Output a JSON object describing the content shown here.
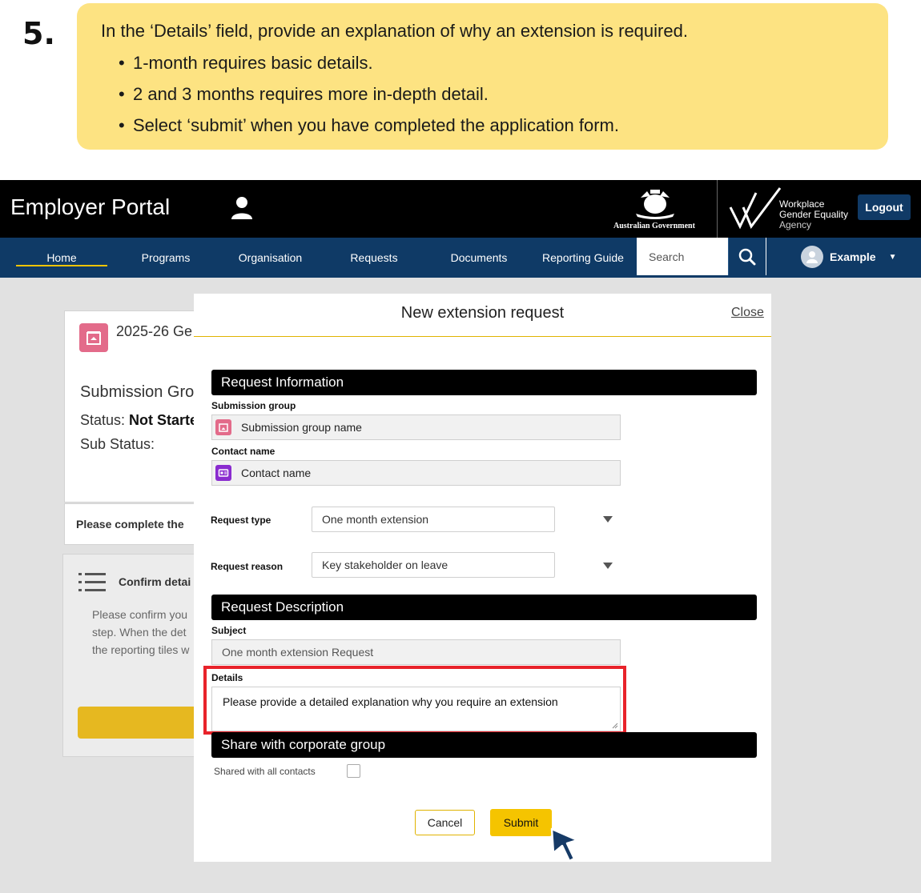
{
  "instruction": {
    "step_number": "5.",
    "main_text": "In the ‘Details’ field, provide an explanation of why an extension is required.",
    "bullets": [
      "1-month requires basic details.",
      "2 and 3 months requires more in-depth detail.",
      "Select ‘submit’ when you have completed the application form."
    ]
  },
  "header": {
    "portal_title": "Employer Portal",
    "govt_logo_text": "Australian Government",
    "agency_name_line1": "Workplace",
    "agency_name_line2": "Gender Equality",
    "agency_name_line3": "Agency",
    "logout_label": "Logout"
  },
  "nav": {
    "items": [
      "Home",
      "Programs",
      "Organisation",
      "Requests",
      "Documents",
      "Reporting Guide"
    ],
    "active": "Home",
    "search_placeholder": "Search",
    "user_name": "Example"
  },
  "background_page": {
    "card_title": "2025-26 Ge",
    "submission_group": "Submission Gro",
    "status_label": "Status:",
    "status_value": "Not Starte",
    "sub_status_label": "Sub Status:",
    "notice_text": "Please complete the",
    "confirm_title": "Confirm detai",
    "confirm_lines": [
      "Please confirm you",
      "step. When the det",
      "the reporting tiles w"
    ]
  },
  "modal": {
    "title": "New extension request",
    "close_label": "Close",
    "section_request_info": "Request Information",
    "submission_group_label": "Submission group",
    "submission_group_value": "Submission group name",
    "contact_name_label": "Contact name",
    "contact_name_value": "Contact name",
    "request_type_label": "Request type",
    "request_type_value": "One month extension",
    "request_reason_label": "Request reason",
    "request_reason_value": "Key stakeholder on leave",
    "section_request_description": "Request Description",
    "subject_label": "Subject",
    "subject_value": "One month extension Request",
    "details_label": "Details",
    "details_value": "Please provide a detailed explanation why you require an extension",
    "section_share": "Share with corporate group",
    "shared_label": "Shared with all contacts",
    "cancel_label": "Cancel",
    "submit_label": "Submit"
  },
  "colors": {
    "callout_bg": "#fde382",
    "nav_bg": "#0f3a66",
    "accent_yellow": "#f5c400",
    "highlight_red": "#e8232a"
  }
}
